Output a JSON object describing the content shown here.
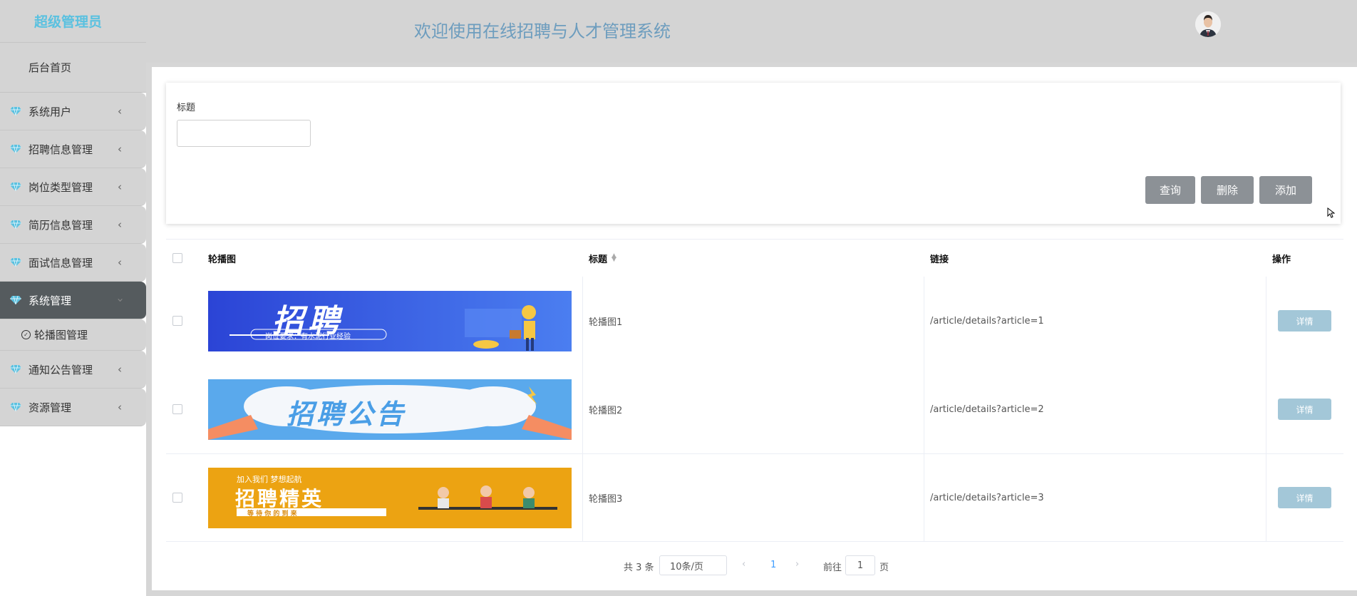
{
  "sidebar": {
    "brand": "超级管理员",
    "home": "后台首页",
    "items": [
      {
        "label": "系统用户"
      },
      {
        "label": "招聘信息管理"
      },
      {
        "label": "岗位类型管理"
      },
      {
        "label": "简历信息管理"
      },
      {
        "label": "面试信息管理"
      },
      {
        "label": "系统管理"
      },
      {
        "label": "通知公告管理"
      },
      {
        "label": "资源管理"
      }
    ],
    "sub_item": "轮播图管理"
  },
  "header": {
    "title": "欢迎使用在线招聘与人才管理系统"
  },
  "search": {
    "label": "标题",
    "value": "",
    "query_label": "查询",
    "delete_label": "删除",
    "add_label": "添加"
  },
  "table": {
    "headers": {
      "image": "轮播图",
      "title": "标题",
      "link": "链接",
      "action": "操作"
    },
    "rows": [
      {
        "title": "轮播图1",
        "link": "/article/details?article=1",
        "action": "详情",
        "banner_text": "招聘",
        "banner_sub": "岗位要求：有水泥行业经验"
      },
      {
        "title": "轮播图2",
        "link": "/article/details?article=2",
        "action": "详情",
        "banner_text": "招聘公告"
      },
      {
        "title": "轮播图3",
        "link": "/article/details?article=3",
        "action": "详情",
        "banner_text": "招聘精英",
        "banner_top": "加入我们 梦想起航",
        "banner_sub": "等 待 你 的 到 来"
      }
    ]
  },
  "pagination": {
    "total": "共 3 条",
    "page_size": "10条/页",
    "current": "1",
    "goto_label": "前往",
    "goto_value": "1",
    "goto_unit": "页"
  },
  "colors": {
    "accent": "#5ac1e0",
    "active_menu": "#555b5e",
    "button": "#8c9196",
    "detail_button": "#a3c7d8",
    "header_title": "#6d9dbe"
  }
}
